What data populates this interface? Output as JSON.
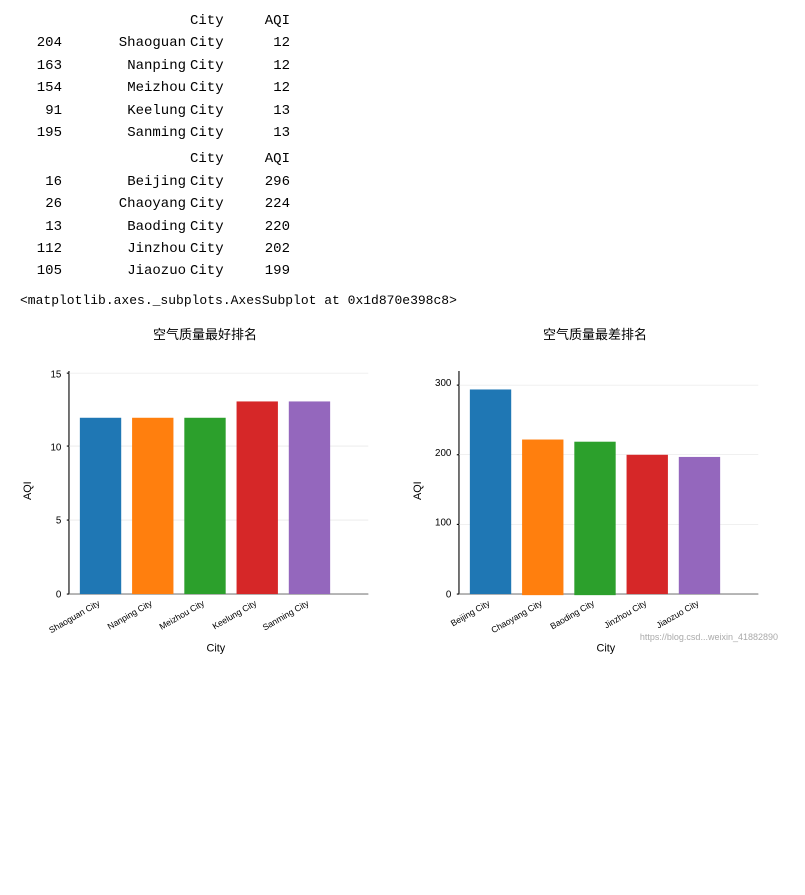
{
  "table1": {
    "header": {
      "city": "City",
      "aqi": "AQI"
    },
    "rows": [
      {
        "index": "204",
        "city": "Shaoguan",
        "label": "City",
        "aqi": "12"
      },
      {
        "index": "163",
        "city": "Nanping",
        "label": "City",
        "aqi": "12"
      },
      {
        "index": "154",
        "city": "Meizhou",
        "label": "City",
        "aqi": "12"
      },
      {
        "index": "91",
        "city": "Keelung",
        "label": "City",
        "aqi": "13"
      },
      {
        "index": "195",
        "city": "Sanming",
        "label": "City",
        "aqi": "13"
      }
    ]
  },
  "table2": {
    "header": {
      "city": "City",
      "aqi": "AQI"
    },
    "rows": [
      {
        "index": "16",
        "city": "Beijing",
        "label": "City",
        "aqi": "296"
      },
      {
        "index": "26",
        "city": "Chaoyang",
        "label": "City",
        "aqi": "224"
      },
      {
        "index": "13",
        "city": "Baoding",
        "label": "City",
        "aqi": "220"
      },
      {
        "index": "112",
        "city": "Jinzhou",
        "label": "City",
        "aqi": "202"
      },
      {
        "index": "105",
        "city": "Jiaozuo",
        "label": "City",
        "aqi": "199"
      }
    ]
  },
  "matplotlib_repr": "<matplotlib.axes._subplots.AxesSubplot at 0x1d870e398c8>",
  "chart_best": {
    "title": "空气质量最好排名",
    "x_label": "City",
    "y_label": "AQI",
    "bars": [
      {
        "city": "Shaoguan City",
        "value": 12,
        "color": "#1f77b4"
      },
      {
        "city": "Nanping City",
        "value": 12,
        "color": "#ff7f0e"
      },
      {
        "city": "Meizhou City",
        "value": 12,
        "color": "#2ca02c"
      },
      {
        "city": "Keelung City",
        "value": 13,
        "color": "#d62728"
      },
      {
        "city": "Sanming City",
        "value": 13,
        "color": "#9467bd"
      }
    ],
    "y_ticks": [
      0,
      5,
      10,
      15
    ],
    "y_max": 15
  },
  "chart_worst": {
    "title": "空气质量最差排名",
    "x_label": "City",
    "y_label": "AQI",
    "bars": [
      {
        "city": "Beijing City",
        "value": 296,
        "color": "#1f77b4"
      },
      {
        "city": "Chaoyang City",
        "value": 224,
        "color": "#ff7f0e"
      },
      {
        "city": "Baoding City",
        "value": 224,
        "color": "#2ca02c"
      },
      {
        "city": "Jinzhou City",
        "value": 202,
        "color": "#d62728"
      },
      {
        "city": "Jiaozuo City",
        "value": 199,
        "color": "#9467bd"
      }
    ],
    "y_ticks": [
      0,
      100,
      200,
      300
    ],
    "y_max": 320
  },
  "watermark": "https://blog.csd...weixin_41882890"
}
